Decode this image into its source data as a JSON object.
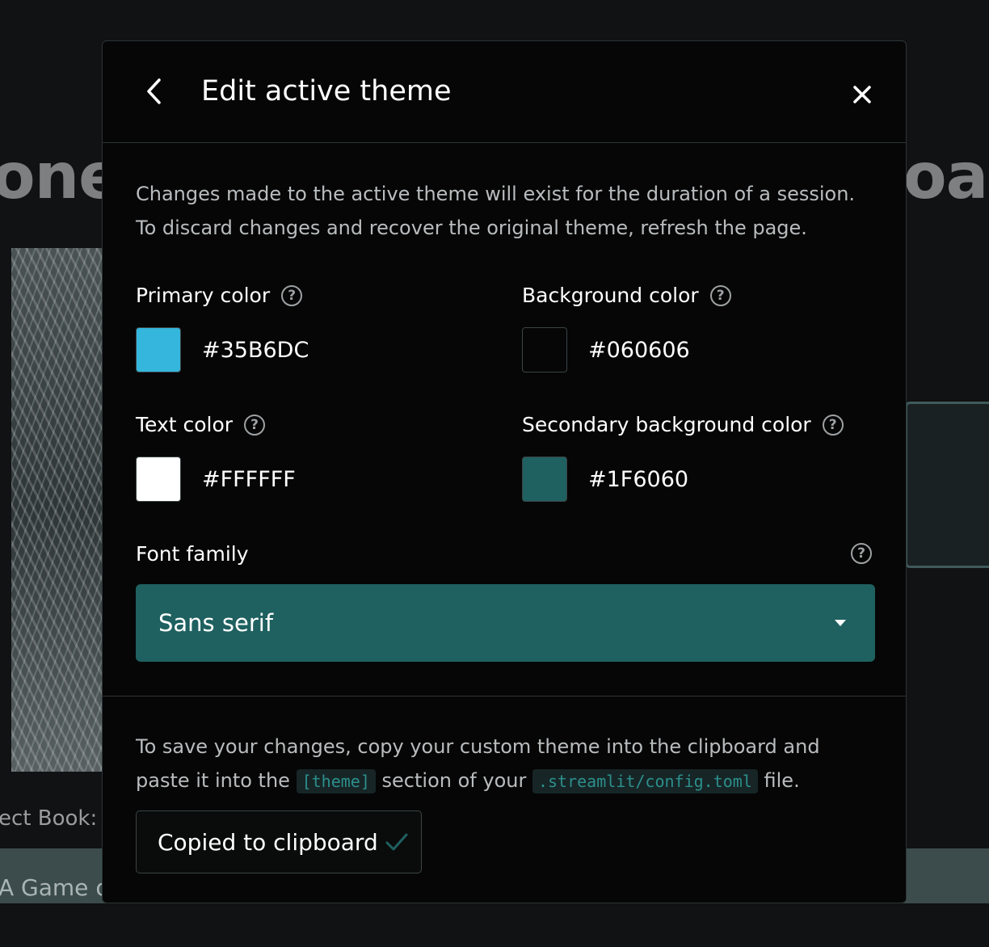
{
  "background": {
    "title_left": "ones",
    "title_right": "oar",
    "select_label": "ect Book:",
    "select_value": "A Game of"
  },
  "modal": {
    "title": "Edit active theme",
    "intro": "Changes made to the active theme will exist for the duration of a session. To discard changes and recover the original theme, refresh the page.",
    "fields": {
      "primary": {
        "label": "Primary color",
        "value": "#35B6DC",
        "color": "#35B6DC"
      },
      "background": {
        "label": "Background color",
        "value": "#060606",
        "color": "#060606"
      },
      "text": {
        "label": "Text color",
        "value": "#FFFFFF",
        "color": "#FFFFFF"
      },
      "secondary": {
        "label": "Secondary background color",
        "value": "#1F6060",
        "color": "#1F6060"
      }
    },
    "font": {
      "label": "Font family",
      "selected": "Sans serif"
    },
    "save": {
      "text_1": "To save your changes, copy your custom theme into the clipboard and paste it into the",
      "code_1": "[theme]",
      "text_2": "section of your",
      "code_2": ".streamlit/config.toml",
      "text_3": "file."
    },
    "copy_button_label": "Copied to clipboard"
  },
  "icons": {
    "back": "chevron-left-icon",
    "close": "close-icon",
    "help": "question-circle-icon",
    "caret": "caret-down-icon",
    "check": "checkmark-icon"
  }
}
